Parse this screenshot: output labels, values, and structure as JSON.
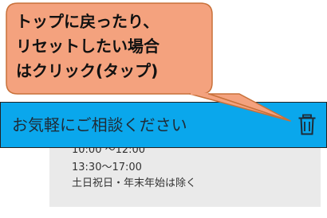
{
  "callout": {
    "lines": [
      "トップに戻ったり、",
      "リセットしたい場合",
      "はクリック(タップ)"
    ],
    "fill_color": "#f4a27e",
    "stroke_color": "#c8713a"
  },
  "chat": {
    "title": "お気軽にご相談ください",
    "header_color": "#0aa7ec",
    "icon": "trash-icon"
  },
  "hours": {
    "lines": [
      "10:00 〜12:00",
      "13:30〜17:00",
      "土日祝日・年末年始は除く"
    ]
  }
}
